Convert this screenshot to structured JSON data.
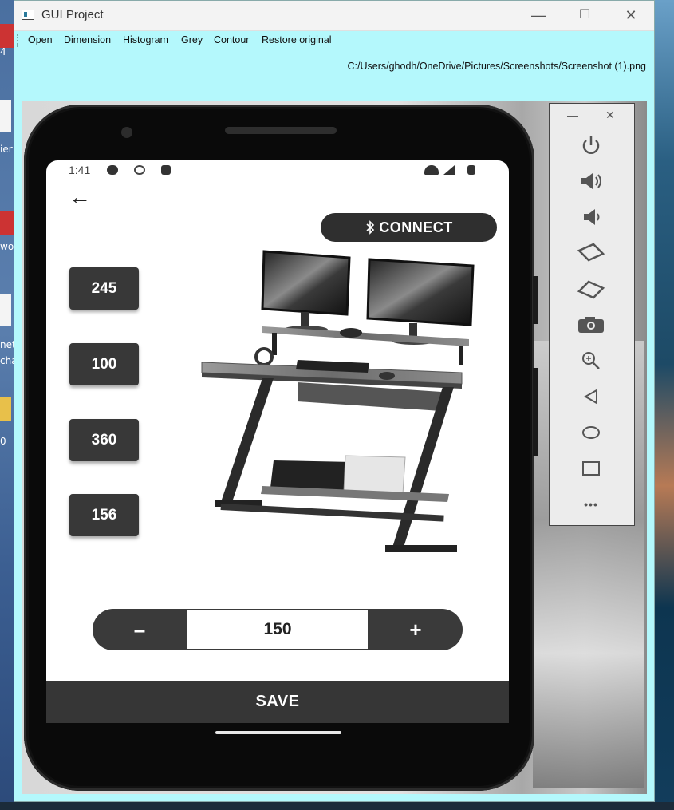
{
  "window": {
    "title": "GUI Project",
    "minimize": "—",
    "maximize": "☐",
    "close": "✕",
    "menu": [
      "Open",
      "Dimension",
      "Histogram",
      "Grey",
      "Contour",
      "Restore original"
    ],
    "file_path": "C:/Users/ghodh/OneDrive/Pictures/Screenshots/Screenshot (1).png"
  },
  "desktop_left_text": [
    "4",
    "ier",
    "wo",
    "net",
    "cha",
    "0"
  ],
  "phone": {
    "status_time": "1:41",
    "back_glyph": "←",
    "connect_label": "CONNECT",
    "connect_icon": "bluetooth-icon",
    "values": [
      "245",
      "100",
      "360",
      "156"
    ],
    "stepper": {
      "minus": "–",
      "value": "150",
      "plus": "+"
    },
    "save_label": "SAVE"
  },
  "emulator_toolbar": {
    "minimize": "—",
    "close": "✕",
    "icons": [
      "power-icon",
      "volume-up-icon",
      "volume-down-icon",
      "rotate-left-icon",
      "rotate-right-icon",
      "camera-icon",
      "zoom-icon",
      "back-icon",
      "home-icon",
      "overview-icon",
      "more-icon"
    ],
    "more_label": "•••"
  },
  "colors": {
    "window_bg": "#b4f8fc",
    "button_dark": "#383838",
    "screen_bg": "#ffffff"
  }
}
